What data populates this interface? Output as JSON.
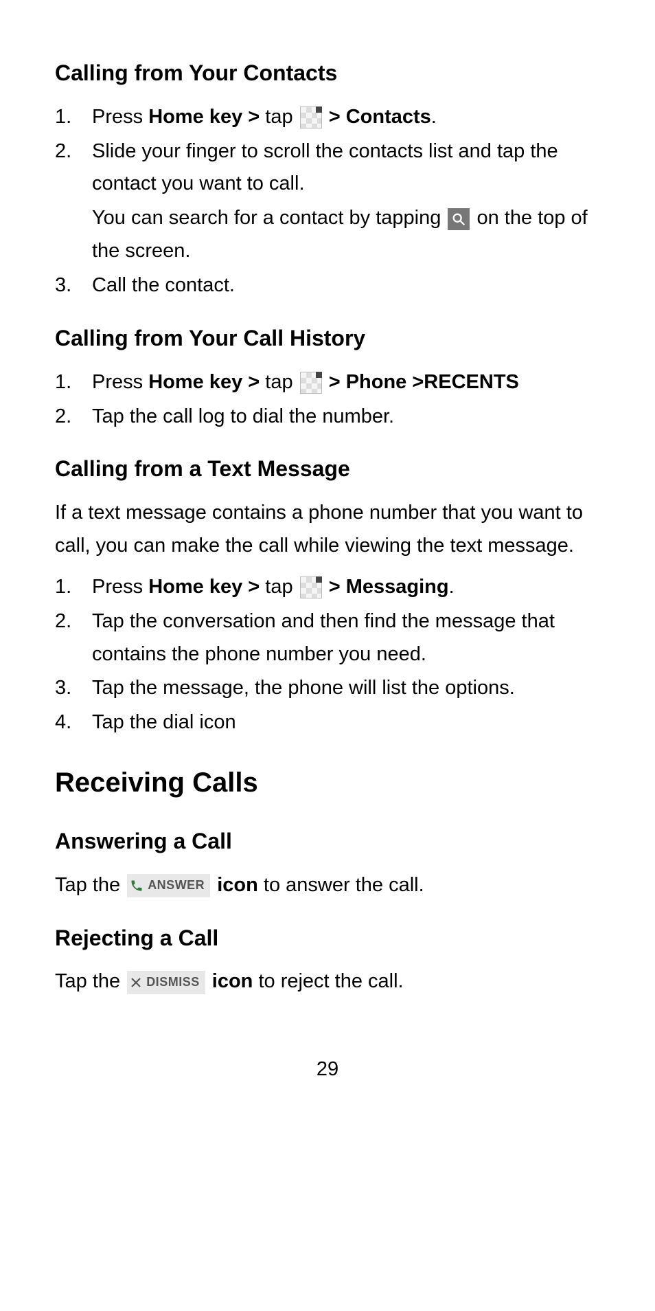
{
  "sec1": {
    "heading": "Calling from Your Contacts",
    "items": [
      {
        "num": "1.",
        "pre": "Press ",
        "b1": "Home key > ",
        "mid": "tap ",
        "b2": "> Contacts",
        "post": "."
      },
      {
        "num": "2.",
        "line1": "Slide your finger to scroll the contacts list and tap the contact you want to call.",
        "line2a": "You can search for a contact by tapping ",
        "line2b": " on the top of the screen."
      },
      {
        "num": "3.",
        "text": "Call the contact."
      }
    ]
  },
  "sec2": {
    "heading": "Calling from Your Call History",
    "items": [
      {
        "num": "1.",
        "pre": "Press ",
        "b1": "Home key > ",
        "mid": "tap ",
        "b2": "> Phone >RECENTS"
      },
      {
        "num": "2.",
        "text": "Tap the call log to dial the number."
      }
    ]
  },
  "sec3": {
    "heading": "Calling from a Text Message",
    "intro": "If a text message contains a phone number that you want to call, you can make the call while viewing the text message.",
    "items": [
      {
        "num": "1.",
        "pre": "Press ",
        "b1": "Home key > ",
        "mid": "tap ",
        "b2": "> Messaging",
        "post": "."
      },
      {
        "num": "2.",
        "text": "Tap the conversation and then find the message that contains the phone number you need."
      },
      {
        "num": "3.",
        "text": "Tap the message, the phone will list the options."
      },
      {
        "num": "4.",
        "text": "Tap the dial icon"
      }
    ]
  },
  "sec4": {
    "major": "Receiving Calls",
    "ans_heading": "Answering a Call",
    "ans_pre": "Tap the ",
    "ans_label": "ANSWER",
    "ans_b": "icon",
    "ans_post": " to answer the call.",
    "rej_heading": "Rejecting a Call",
    "rej_pre": "Tap the ",
    "rej_label": "DISMISS",
    "rej_b": "icon",
    "rej_post": " to reject the call."
  },
  "page": "29"
}
